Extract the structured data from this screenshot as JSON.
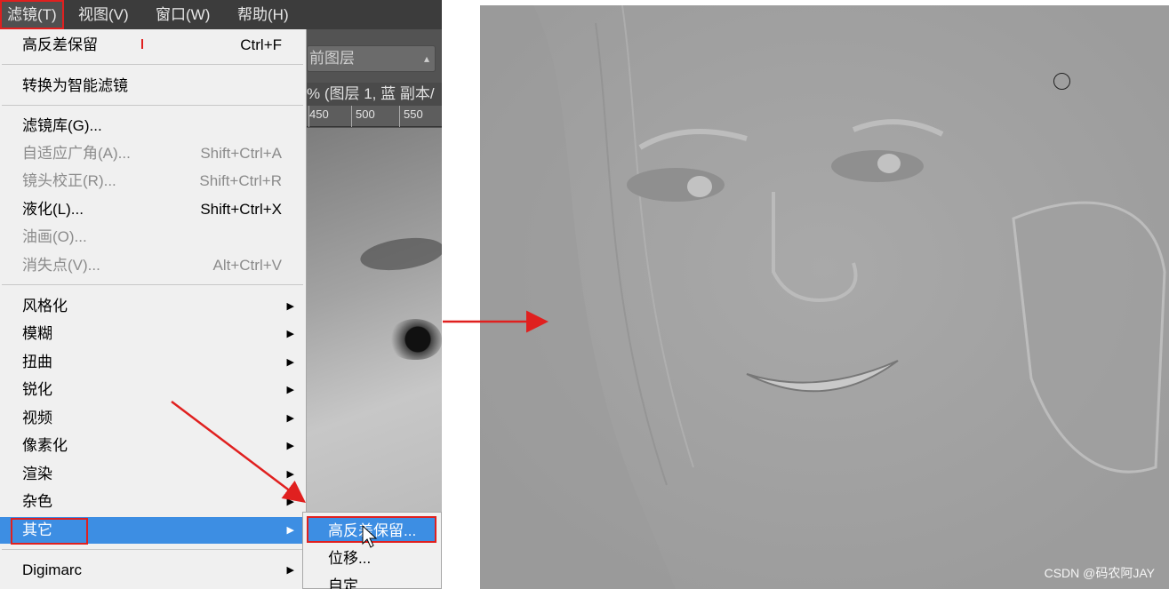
{
  "menubar": {
    "items": [
      "滤镜(T)",
      "视图(V)",
      "窗口(W)",
      "帮助(H)"
    ]
  },
  "panel": {
    "layer_select": "前图层",
    "doc_tab": "% (图层 1, 蓝 副本/",
    "ruler_ticks": [
      "450",
      "500",
      "550"
    ]
  },
  "filter_menu": {
    "last_filter": {
      "label": "高反差保留",
      "shortcut": "Ctrl+F"
    },
    "smart": "转换为智能滤镜",
    "gallery": "滤镜库(G)...",
    "adaptive": {
      "label": "自适应广角(A)...",
      "shortcut": "Shift+Ctrl+A"
    },
    "lens": {
      "label": "镜头校正(R)...",
      "shortcut": "Shift+Ctrl+R"
    },
    "liquify": {
      "label": "液化(L)...",
      "shortcut": "Shift+Ctrl+X"
    },
    "oil": "油画(O)...",
    "vanish": {
      "label": "消失点(V)...",
      "shortcut": "Alt+Ctrl+V"
    },
    "groups": [
      "风格化",
      "模糊",
      "扭曲",
      "锐化",
      "视频",
      "像素化",
      "渲染",
      "杂色",
      "其它"
    ],
    "digimarc": "Digimarc"
  },
  "submenu": {
    "items": [
      "高反差保留...",
      "位移...",
      "自定"
    ]
  },
  "watermark": "CSDN @码农阿JAY",
  "colors": {
    "highlight": "#3d8ee3",
    "annotation_red": "#e0201f"
  }
}
